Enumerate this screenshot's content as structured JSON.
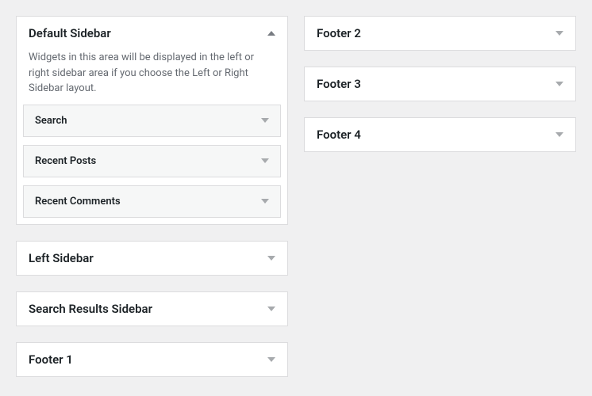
{
  "left_column": {
    "expanded_panel": {
      "title": "Default Sidebar",
      "description": "Widgets in this area will be displayed in the left or right sidebar area if you choose the Left or Right Sidebar layout.",
      "widgets": [
        {
          "title": "Search"
        },
        {
          "title": "Recent Posts"
        },
        {
          "title": "Recent Comments"
        }
      ]
    },
    "collapsed_panels": [
      {
        "title": "Left Sidebar"
      },
      {
        "title": "Search Results Sidebar"
      },
      {
        "title": "Footer 1"
      }
    ]
  },
  "right_column": {
    "collapsed_panels": [
      {
        "title": "Footer 2"
      },
      {
        "title": "Footer 3"
      },
      {
        "title": "Footer 4"
      }
    ]
  }
}
